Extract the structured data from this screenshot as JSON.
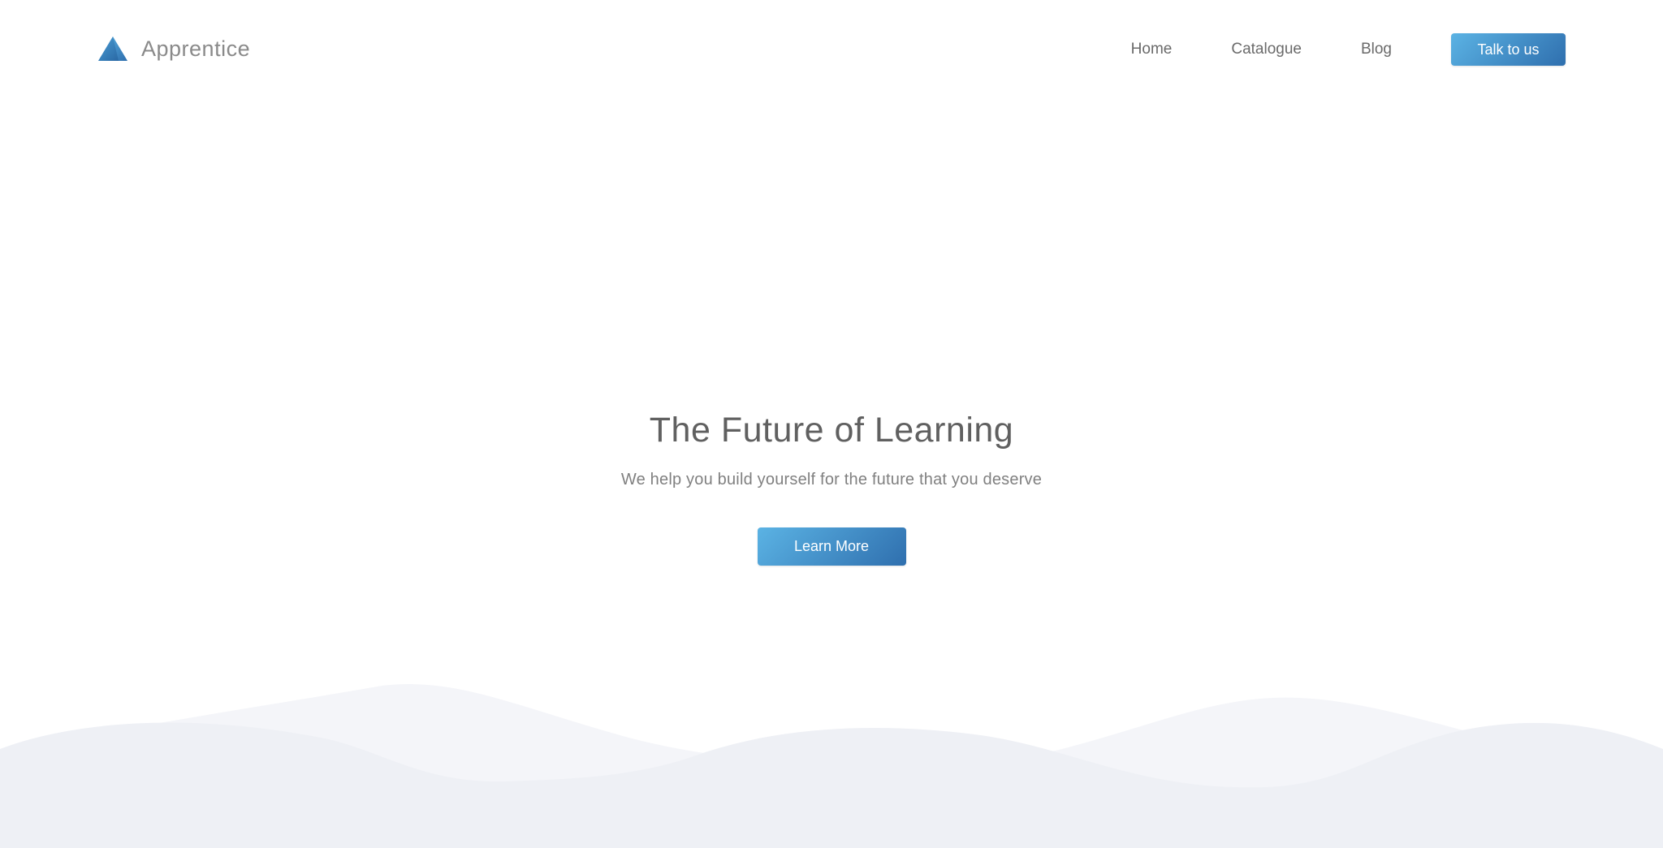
{
  "brand": {
    "name": "Apprentice",
    "logo_icon": "triangle-logo-icon"
  },
  "nav": {
    "items": [
      {
        "label": "Home"
      },
      {
        "label": "Catalogue"
      },
      {
        "label": "Blog"
      }
    ],
    "cta_label": "Talk to us"
  },
  "hero": {
    "title": "The Future of Learning",
    "subtitle": "We help you build yourself for the future that you deserve",
    "button_label": "Learn More"
  },
  "colors": {
    "accent_light": "#5bb3e4",
    "accent_dark": "#2f6fae",
    "wave_back": "#f4f5f9",
    "wave_front": "#eef0f5",
    "text_dark": "#606060",
    "text_muted": "#808080"
  }
}
